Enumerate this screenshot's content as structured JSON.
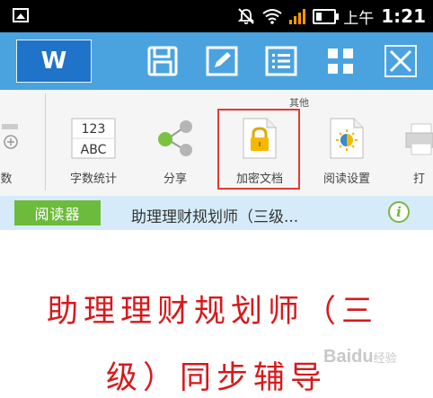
{
  "status_bar": {
    "period": "上午",
    "time": "1:21",
    "icons": [
      "image-icon",
      "mute-icon",
      "wifi-icon",
      "signal-icon",
      "battery-icon"
    ]
  },
  "toolbar": {
    "logo": "W",
    "icons": [
      "save-icon",
      "edit-icon",
      "list-icon",
      "grid-icon",
      "close-icon"
    ]
  },
  "ribbon": {
    "group_label": "其他",
    "items": [
      {
        "label": "数",
        "icon": "partial-icon"
      },
      {
        "label": "字数统计",
        "icon": "word-count-icon",
        "icon_text_top": "123",
        "icon_text_bottom": "ABC"
      },
      {
        "label": "分享",
        "icon": "share-icon"
      },
      {
        "label": "加密文档",
        "icon": "lock-document-icon"
      },
      {
        "label": "阅读设置",
        "icon": "reading-settings-icon"
      },
      {
        "label": "打",
        "icon": "print-icon"
      }
    ]
  },
  "reader_bar": {
    "reader_button": "阅读器",
    "document_title": "助理理财规划师（三级...",
    "info_icon": "i"
  },
  "document": {
    "lines": [
      "助理理财规划师（三",
      "级）同步辅导"
    ]
  },
  "watermark": {
    "text": "Baidu",
    "suffix": "经验"
  },
  "colors": {
    "status_bar": "#000000",
    "title_bar": "#4aa3df",
    "logo": "#1f73c9",
    "ribbon": "#f5f5f5",
    "reader_bar": "#d6ebfa",
    "reader_button": "#6cbb3c",
    "document_text": "#d7191c",
    "highlight": "#e53935"
  }
}
